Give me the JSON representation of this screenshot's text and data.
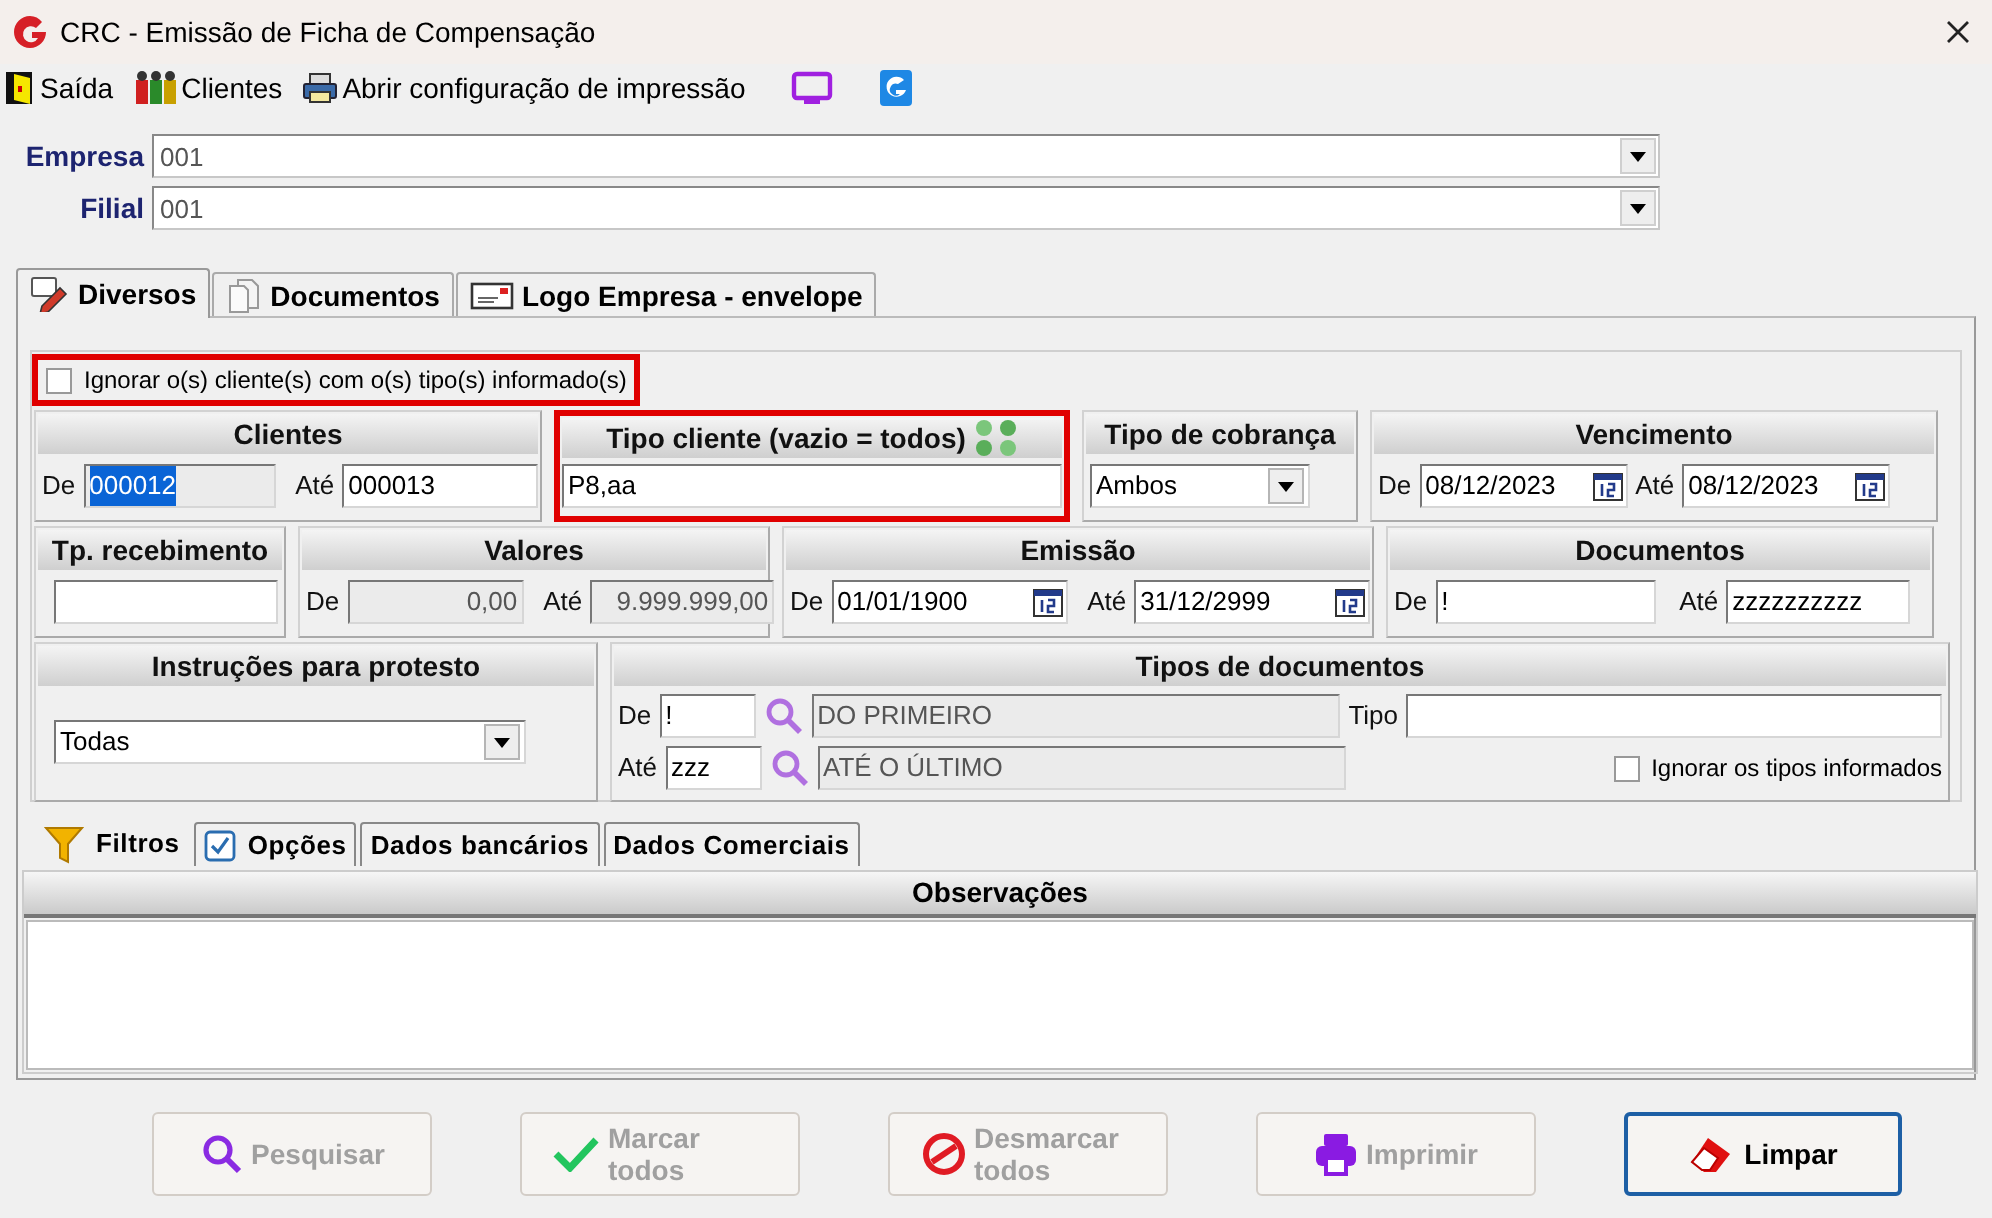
{
  "window": {
    "title": "CRC - Emissão de Ficha de Compensação"
  },
  "toolbar": [
    {
      "kind": "exit",
      "label": "Saída"
    },
    {
      "kind": "clients",
      "label": "Clientes"
    },
    {
      "kind": "printer",
      "label": "Abrir configuração de impressão"
    },
    {
      "kind": "monitor"
    },
    {
      "kind": "logo"
    }
  ],
  "company": {
    "label": "Empresa",
    "value": "001"
  },
  "branch": {
    "label": "Filial",
    "value": "001"
  },
  "tabs": [
    {
      "kind": "pencil",
      "label": "Diversos",
      "selected": true
    },
    {
      "kind": "document",
      "label": "Documentos",
      "selected": false
    },
    {
      "kind": "envelope",
      "label": "Logo Empresa - envelope",
      "selected": false
    }
  ],
  "ignore_clients": {
    "label": "Ignorar o(s) cliente(s) com o(s) tipo(s) informado(s)",
    "checked": false,
    "highlighted": true
  },
  "group_rows": [
    [
      {
        "title": "Clientes",
        "kind": "plain",
        "highlighted": false,
        "lines": [
          [
            {
              "kind": "label",
              "text": "De"
            },
            {
              "kind": "input",
              "value": "000012",
              "disabled": true,
              "selected": true
            },
            {
              "kind": "label",
              "text": "Até"
            },
            {
              "kind": "input",
              "value": "000013"
            }
          ]
        ]
      },
      {
        "title": "Tipo cliente (vazio = todos)",
        "kind": "action",
        "highlighted": true,
        "lines": [
          [
            {
              "kind": "input",
              "value": "P8,aa"
            }
          ]
        ]
      },
      {
        "title": "Tipo de cobrança",
        "kind": "plain",
        "highlighted": false,
        "lines": [
          [
            {
              "kind": "select",
              "value": "Ambos"
            }
          ]
        ]
      },
      {
        "title": "Vencimento",
        "kind": "plain",
        "highlighted": false,
        "lines": [
          [
            {
              "kind": "label",
              "text": "De"
            },
            {
              "kind": "date",
              "value": "08/12/2023"
            },
            {
              "kind": "label",
              "text": "Até"
            },
            {
              "kind": "date",
              "value": "08/12/2023"
            }
          ]
        ]
      }
    ],
    [
      {
        "title": "Tp. recebimento",
        "kind": "plain",
        "highlighted": false,
        "lines": [
          [
            {
              "kind": "input"
            }
          ]
        ]
      },
      {
        "title": "Valores",
        "kind": "plain",
        "highlighted": false,
        "lines": [
          [
            {
              "kind": "label",
              "text": "De"
            },
            {
              "kind": "number",
              "value": "0,00",
              "disabled": true
            },
            {
              "kind": "label",
              "text": "Até"
            },
            {
              "kind": "number",
              "value": "9.999.999,00",
              "disabled": true
            }
          ]
        ]
      },
      {
        "title": "Emissão",
        "kind": "plain",
        "highlighted": false,
        "lines": [
          [
            {
              "kind": "label",
              "text": "De"
            },
            {
              "kind": "date",
              "value": "01/01/1900"
            },
            {
              "kind": "label",
              "text": "Até"
            },
            {
              "kind": "date",
              "value": "31/12/2999"
            }
          ]
        ]
      },
      {
        "title": "Documentos",
        "kind": "plain",
        "highlighted": false,
        "lines": [
          [
            {
              "kind": "label",
              "text": "De"
            },
            {
              "kind": "input",
              "value": "!"
            },
            {
              "kind": "label",
              "text": "Até"
            },
            {
              "kind": "input",
              "value": "zzzzzzzzzz"
            }
          ]
        ]
      }
    ],
    [
      {
        "title": "Instruções para protesto",
        "kind": "plain",
        "highlighted": false,
        "lines": [
          [
            {
              "kind": "select",
              "value": "Todas"
            }
          ]
        ]
      },
      {
        "title": "Tipos de documentos",
        "kind": "plain",
        "highlighted": false,
        "lines": [
          [
            {
              "kind": "label",
              "text": "De"
            },
            {
              "kind": "input",
              "value": "!"
            },
            {
              "kind": "search"
            },
            {
              "kind": "input",
              "value": "DO PRIMEIRO",
              "disabled": true
            },
            {
              "kind": "label",
              "text": "Tipo"
            },
            {
              "kind": "input"
            }
          ],
          [
            {
              "kind": "label",
              "text": "Até"
            },
            {
              "kind": "input",
              "value": "zzz"
            },
            {
              "kind": "search"
            },
            {
              "kind": "input",
              "value": "ATÉ O ÚLTIMO",
              "disabled": true
            },
            {
              "kind": "checkbox",
              "label": "Ignorar os tipos informados",
              "checked": false
            }
          ]
        ]
      }
    ]
  ],
  "lower_tabs": [
    {
      "kind": "funnel",
      "label": "Filtros",
      "selected": true
    },
    {
      "kind": "checkbox",
      "label": "Opções",
      "selected": false
    },
    {
      "kind": "plain",
      "label": "Dados bancários",
      "selected": false
    },
    {
      "kind": "plain",
      "label": "Dados Comerciais",
      "selected": false
    }
  ],
  "notes": {
    "title": "Observações"
  },
  "buttons": [
    {
      "kind": "search",
      "label": "Pesquisar",
      "disabled": true,
      "default": false
    },
    {
      "kind": "check",
      "label": "Marcar todos",
      "disabled": true,
      "default": false
    },
    {
      "kind": "cancel",
      "label": "Desmarcar todos",
      "disabled": true,
      "default": false
    },
    {
      "kind": "print",
      "label": "Imprimir",
      "disabled": true,
      "default": false
    },
    {
      "kind": "eraser",
      "label": "Limpar",
      "disabled": false,
      "default": true
    }
  ]
}
